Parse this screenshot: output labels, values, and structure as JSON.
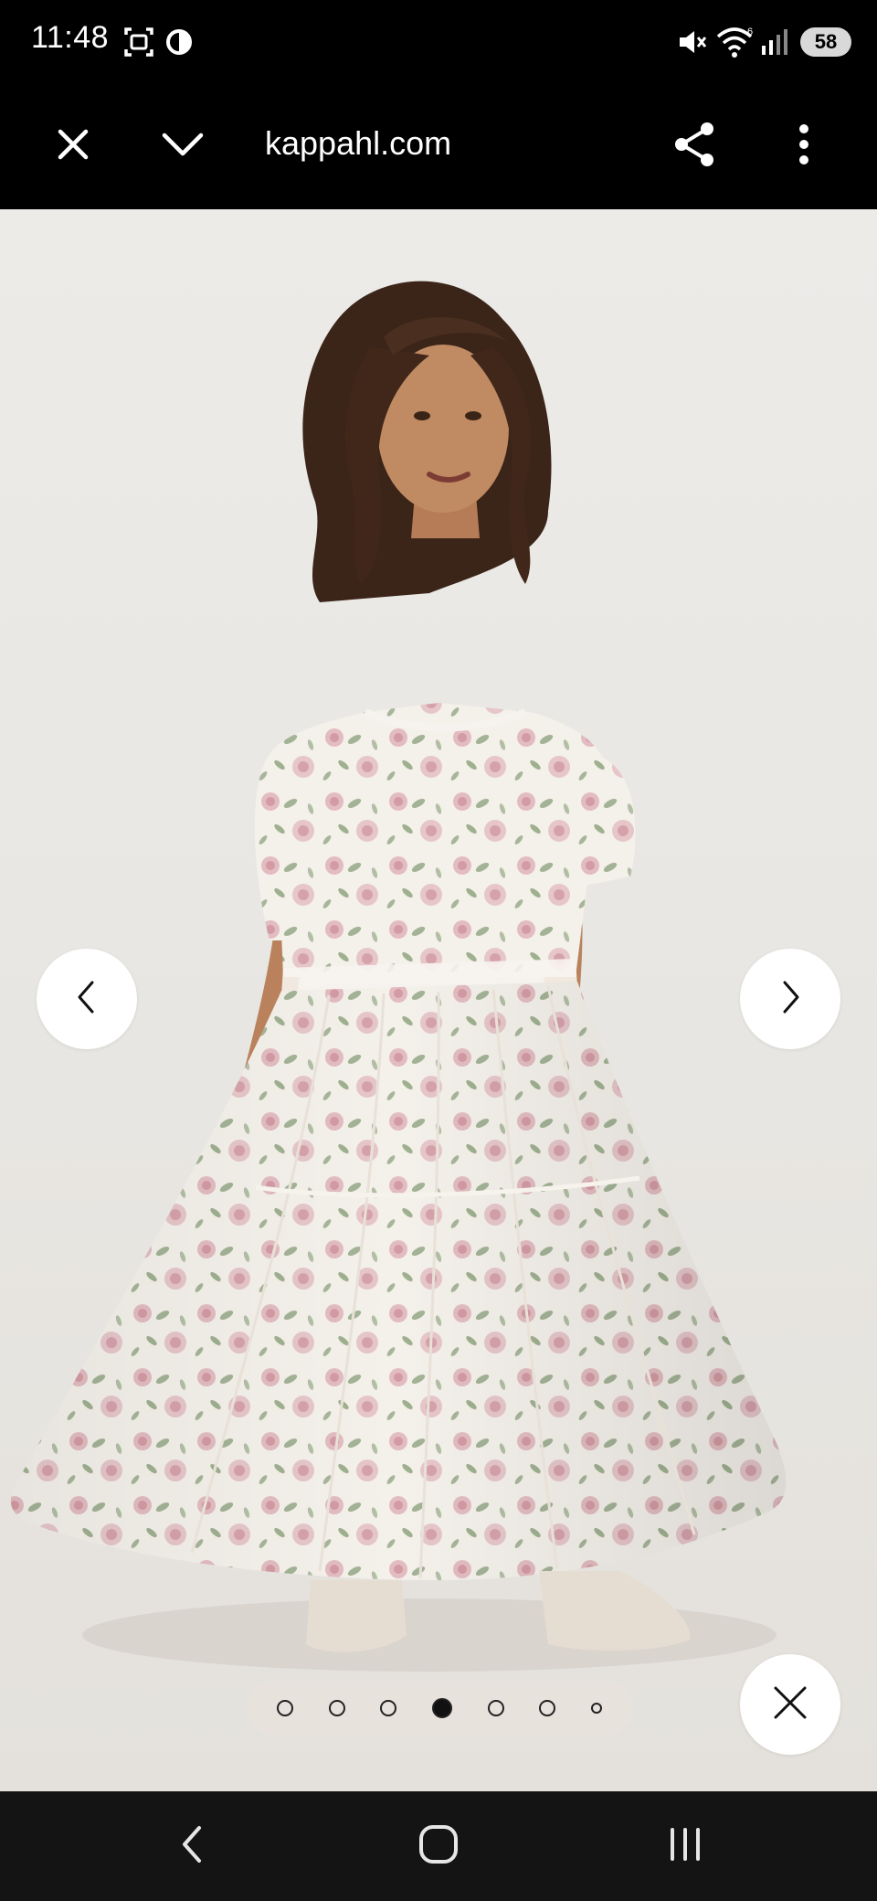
{
  "status_bar": {
    "time": "11:48",
    "battery": "58",
    "icons": [
      "screenshot-icon",
      "data-saver-icon",
      "mute-icon",
      "wifi-icon",
      "signal-icon",
      "battery-icon"
    ]
  },
  "toolbar": {
    "url": "kappahl.com",
    "icons": [
      "close-icon",
      "chevron-down-icon",
      "share-icon",
      "more-vert-icon"
    ]
  },
  "viewer": {
    "image_alt": "Woman wearing long floral maxi dress",
    "total_images": 7,
    "active_index": 4,
    "icons": [
      "chevron-left-icon",
      "chevron-right-icon",
      "close-icon"
    ]
  },
  "nav_bar": {
    "icons": [
      "back-icon",
      "home-icon",
      "recents-icon"
    ]
  },
  "colors": {
    "background": "#ebe9e5",
    "dress_base": "#f5f1ec",
    "rose_pink": "#d8a4ad",
    "leaf_green": "#9fae93",
    "hair": "#3b2418",
    "skin": "#b9825c"
  }
}
